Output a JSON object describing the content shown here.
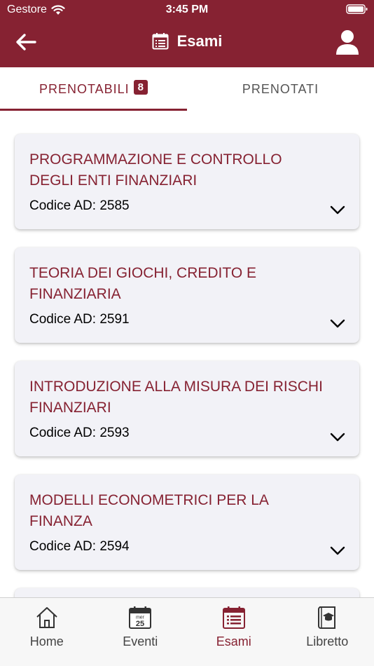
{
  "status_bar": {
    "carrier": "Gestore",
    "time": "3:45 PM"
  },
  "header": {
    "title": "Esami"
  },
  "tabs": [
    {
      "label": "PRENOTABILI",
      "badge": "8",
      "active": true
    },
    {
      "label": "PRENOTATI",
      "active": false
    }
  ],
  "cards": [
    {
      "title": "PROGRAMMAZIONE E CONTROLLO DEGLI ENTI FINANZIARI",
      "code": "Codice AD: 2585"
    },
    {
      "title": "TEORIA DEI GIOCHI, CREDITO E FINANZIARIA",
      "code": "Codice AD: 2591"
    },
    {
      "title": "INTRODUZIONE ALLA MISURA DEI RISCHI FINANZIARI",
      "code": "Codice AD: 2593"
    },
    {
      "title": "MODELLI ECONOMETRICI PER LA FINANZA",
      "code": "Codice AD: 2594"
    }
  ],
  "tabbar": [
    {
      "label": "Home",
      "icon": "home-icon"
    },
    {
      "label": "Eventi",
      "icon": "calendar-icon",
      "icon_day": "mer",
      "icon_date": "25"
    },
    {
      "label": "Esami",
      "icon": "exam-list-icon",
      "active": true
    },
    {
      "label": "Libretto",
      "icon": "grade-book-icon"
    }
  ],
  "colors": {
    "brand": "#862232",
    "card_bg": "#f2f2f7",
    "tabbar_bg": "#f7f7f7"
  }
}
